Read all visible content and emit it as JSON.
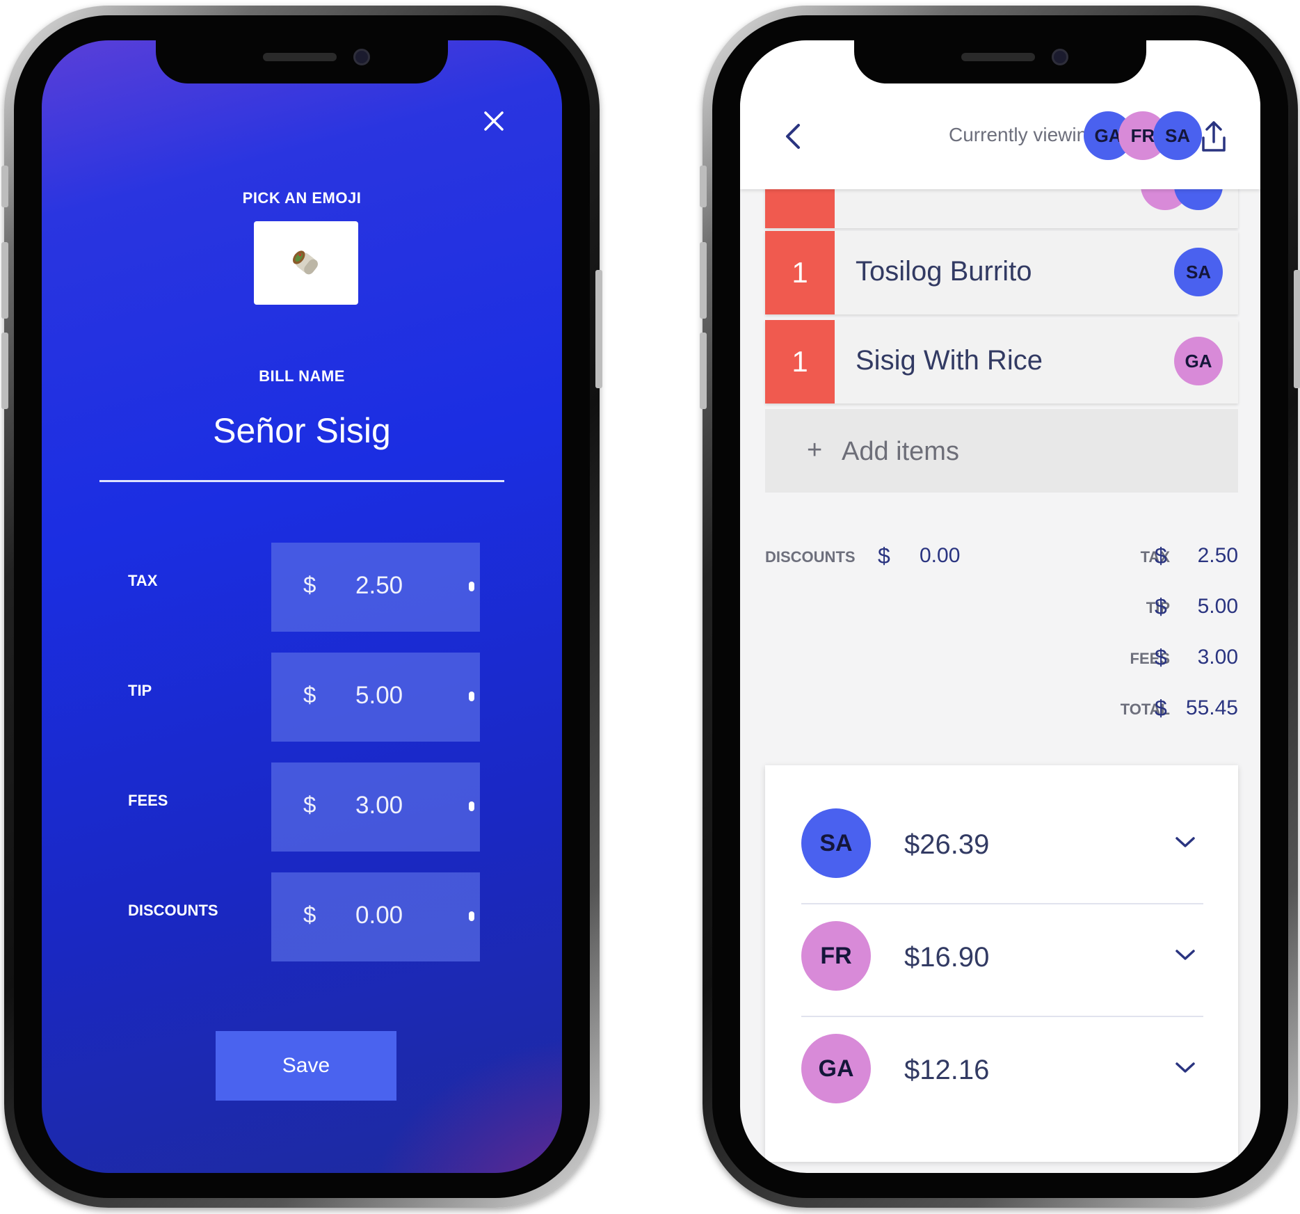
{
  "left": {
    "pick_emoji_label": "PICK AN EMOJI",
    "emoji": "🌯",
    "bill_name_label": "BILL NAME",
    "bill_name": "Señor Sisig",
    "fields": [
      {
        "label": "TAX",
        "currency": "$",
        "value": "2.50"
      },
      {
        "label": "TIP",
        "currency": "$",
        "value": "5.00"
      },
      {
        "label": "FEES",
        "currency": "$",
        "value": "3.00"
      },
      {
        "label": "DISCOUNTS",
        "currency": "$",
        "value": "0.00"
      }
    ],
    "save_label": "Save",
    "close_icon": "close-icon"
  },
  "right": {
    "currently_viewing_label": "Currently viewing",
    "viewers": [
      {
        "initials": "GA",
        "color": "#d88ad8"
      },
      {
        "initials": "FR",
        "color": "#d88ad8"
      },
      {
        "initials": "SA",
        "color": "#4a61ef"
      }
    ],
    "items": [
      {
        "qty": "1",
        "name": "Tosilog Burrito",
        "assignee": "SA"
      },
      {
        "qty": "1",
        "name": "Sisig With Rice",
        "assignee": "GA"
      }
    ],
    "add_items_label": "Add items",
    "summary": {
      "discounts": {
        "label": "DISCOUNTS",
        "currency": "$",
        "value": "0.00"
      },
      "tax": {
        "label": "TAX",
        "currency": "$",
        "value": "2.50"
      },
      "tip": {
        "label": "TIP",
        "currency": "$",
        "value": "5.00"
      },
      "fees": {
        "label": "FEES",
        "currency": "$",
        "value": "3.00"
      },
      "total": {
        "label": "TOTAL",
        "currency": "$",
        "value": "55.45"
      }
    },
    "splits": [
      {
        "initials": "SA",
        "amount": "$26.39",
        "color": "#4a61ef"
      },
      {
        "initials": "FR",
        "amount": "$16.90",
        "color": "#d88ad8"
      },
      {
        "initials": "GA",
        "amount": "$12.16",
        "color": "#d88ad8"
      }
    ]
  },
  "colors": {
    "accent_blue": "#4a61ef",
    "accent_pink": "#d88ad8",
    "qty_red": "#f05a4f",
    "save_button": "#4a63ef"
  }
}
